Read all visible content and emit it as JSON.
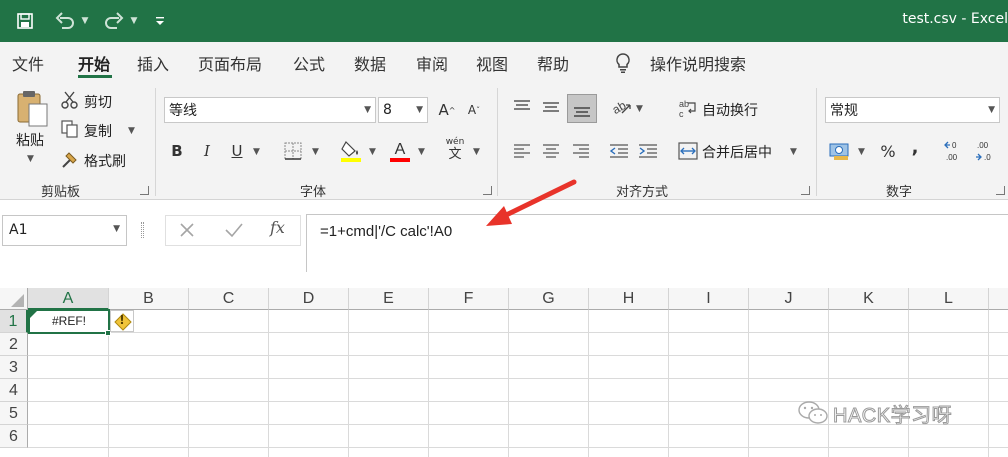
{
  "title_bar": {
    "title": "test.csv  -  Excel"
  },
  "tabs": [
    "文件",
    "开始",
    "插入",
    "页面布局",
    "公式",
    "数据",
    "审阅",
    "视图",
    "帮助"
  ],
  "tell_me": "操作说明搜索",
  "clipboard": {
    "paste_label": "粘贴",
    "cut_label": "剪切",
    "copy_label": "复制",
    "format_painter_label": "格式刷",
    "group_label": "剪贴板"
  },
  "font": {
    "font_name": "等线",
    "font_size": "8",
    "bold": "B",
    "italic": "I",
    "underline": "U",
    "pinyin_top": "wén",
    "pinyin_bottom": "文",
    "group_label": "字体",
    "font_color": "#ff0000",
    "fill_color": "#ffff00"
  },
  "alignment": {
    "wrap_text_label": "自动换行",
    "merge_center_label": "合并后居中",
    "group_label": "对齐方式"
  },
  "number": {
    "format": "常规",
    "percent": "%",
    "comma": ",",
    "group_label": "数字"
  },
  "formula_bar": {
    "name_box": "A1",
    "fx": "fx",
    "formula": "=1+cmd|'/C calc'!A0"
  },
  "sheet": {
    "columns": [
      "A",
      "B",
      "C",
      "D",
      "E",
      "F",
      "G",
      "H",
      "I",
      "J",
      "K",
      "L"
    ],
    "rows": [
      "1",
      "2",
      "3",
      "4",
      "5",
      "6"
    ],
    "cell_a1": "#REF!",
    "error_badge": "!"
  },
  "watermark": "HACK学习呀",
  "colors": {
    "brand": "#217346",
    "arrow": "#e8332a",
    "selection": "#217346"
  }
}
